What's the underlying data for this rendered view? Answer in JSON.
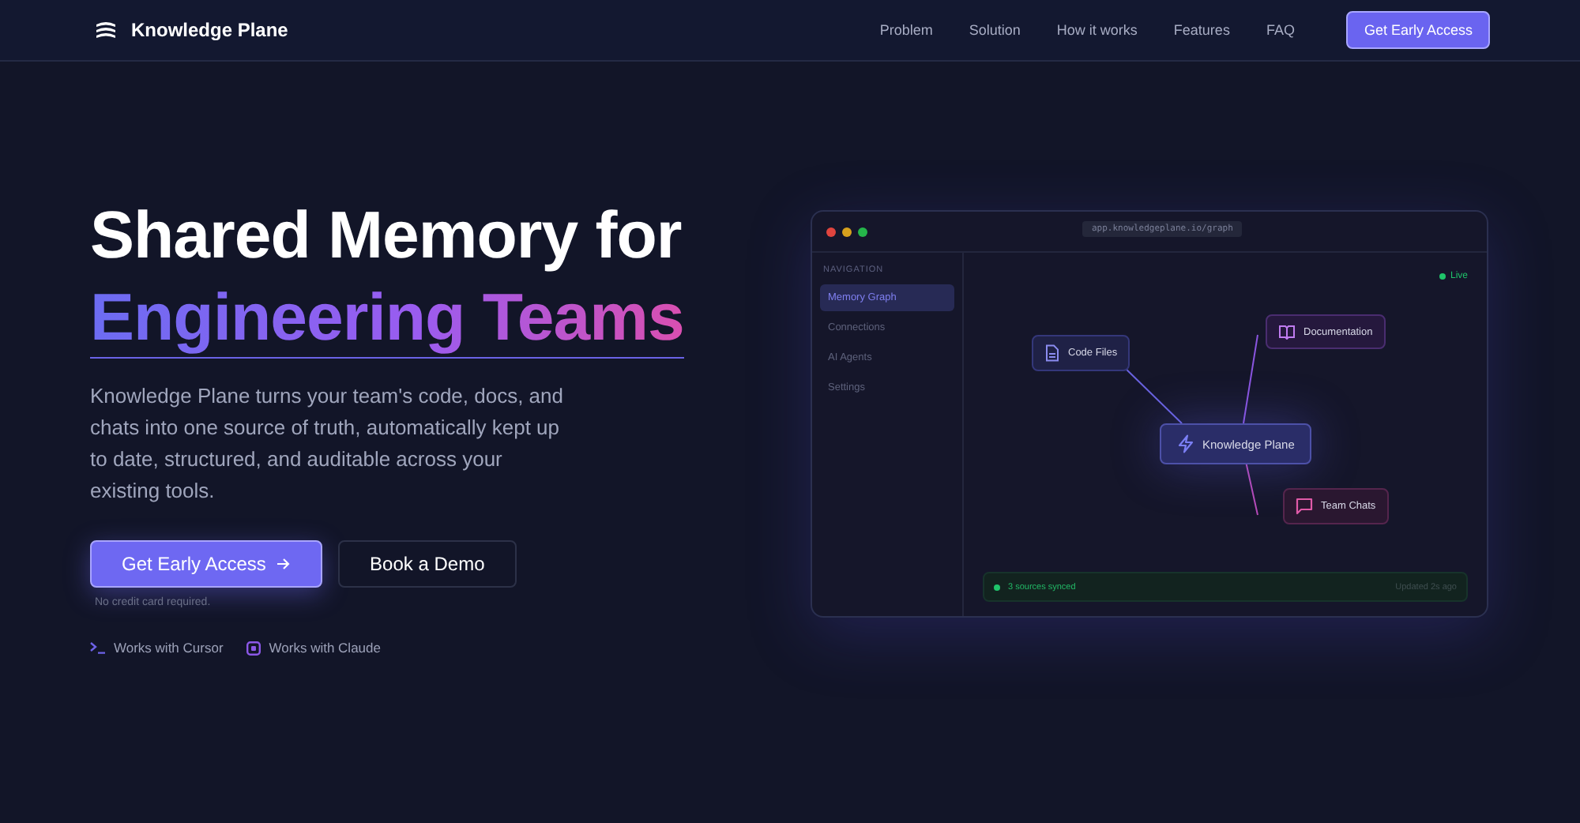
{
  "nav": {
    "brand": "Knowledge Plane",
    "links": [
      "Problem",
      "Solution",
      "How it works",
      "Features",
      "FAQ"
    ],
    "cta": "Get Early Access"
  },
  "hero": {
    "title_line_1": "Shared Memory for",
    "title_line_2": "Engineering Teams",
    "description": "Knowledge Plane turns your team's code, docs, and chats into one source of truth, automatically kept up to date, structured, and auditable across your existing tools.",
    "primary_button": "Get Early Access",
    "secondary_button": "Book a Demo",
    "note": "No credit card required.",
    "integrations": [
      {
        "kind": "terminal",
        "label": "Works with Cursor"
      },
      {
        "kind": "square",
        "label": "Works with Claude"
      }
    ]
  },
  "app_window": {
    "url": "app.knowledgeplane.io/graph",
    "sidebar_heading": "NAVIGATION",
    "sidebar_items": [
      {
        "label": "Memory Graph",
        "selected": true
      },
      {
        "label": "Connections",
        "selected": false
      },
      {
        "label": "AI Agents",
        "selected": false
      },
      {
        "label": "Settings",
        "selected": false
      }
    ],
    "live_label": "Live",
    "nodes": [
      {
        "kind": "file",
        "label": "Code Files"
      },
      {
        "kind": "book",
        "label": "Documentation"
      },
      {
        "kind": "bolt",
        "label": "Knowledge Plane"
      },
      {
        "kind": "chat",
        "label": "Team Chats"
      }
    ],
    "status": "3 sources synced",
    "updated": "Updated 2s ago"
  }
}
